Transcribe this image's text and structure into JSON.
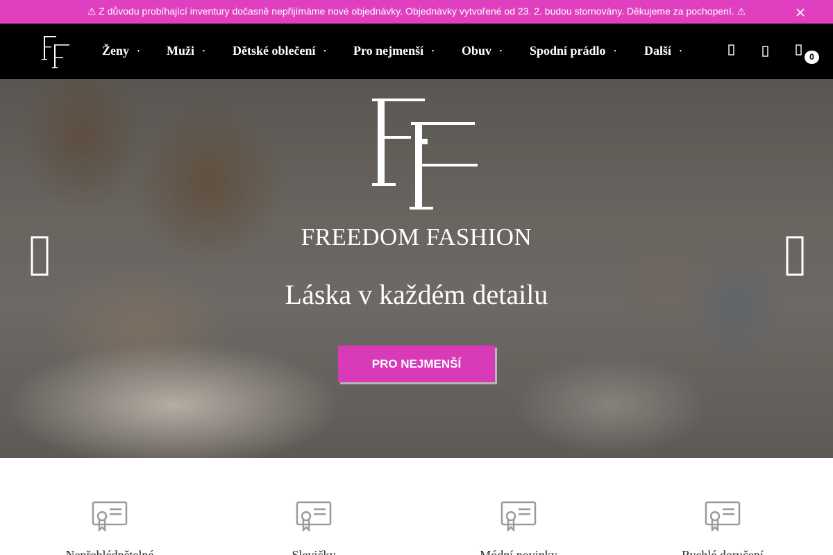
{
  "announcement": {
    "text": "⚠ Z důvodu probíhající inventury dočasně nepřijímáme nové objednávky. Objednávky vytvořené od 23. 2. budou stornovány. Děkujeme za pochopení. ⚠",
    "close_icon": "close-icon",
    "background_color": "#e040c0"
  },
  "header": {
    "logo_icon": "ff-monogram-logo",
    "nav": [
      {
        "label": "Ženy"
      },
      {
        "label": "Muži"
      },
      {
        "label": "Dětské oblečení"
      },
      {
        "label": "Pro nejmenší"
      },
      {
        "label": "Obuv"
      },
      {
        "label": "Spodní prádlo"
      },
      {
        "label": "Další"
      }
    ],
    "nav_caret": "▾",
    "icons": [
      "search-icon",
      "user-icon",
      "cart-icon"
    ],
    "cart_count": "0"
  },
  "hero": {
    "brand": "FREEDOM FASHION",
    "headline": "Láska v každém detailu",
    "cta_label": "PRO NEJMENŠÍ",
    "accent_color": "#d83ab8",
    "prev_icon": "chevron-left-icon",
    "next_icon": "chevron-right-icon"
  },
  "features": [
    {
      "icon": "certificate-icon",
      "label": "Nepřehlédnětelné"
    },
    {
      "icon": "certificate-icon",
      "label": "Slevičky"
    },
    {
      "icon": "certificate-icon",
      "label": "Módní novinky"
    },
    {
      "icon": "certificate-icon",
      "label": "Rychlé doručení"
    }
  ]
}
